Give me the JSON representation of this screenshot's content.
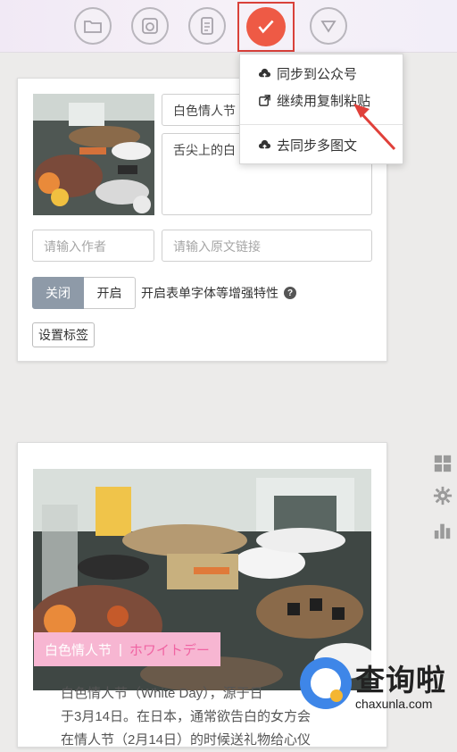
{
  "toolbar": {
    "buttons": [
      {
        "icon": "folder-icon"
      },
      {
        "icon": "camera-icon"
      },
      {
        "icon": "clipboard-icon"
      },
      {
        "icon": "check-icon",
        "active": true
      },
      {
        "icon": "triangle-down-icon"
      }
    ],
    "accent": "#ee5a45",
    "highlight_border": "#d9413a"
  },
  "sync_menu": {
    "items": [
      {
        "icon": "cloud-upload-icon",
        "label": "同步到公众号"
      },
      {
        "icon": "external-link-icon",
        "label": "继续用复制粘贴"
      },
      {
        "icon": "cloud-upload-icon",
        "label": "去同步多图文"
      }
    ]
  },
  "article_form": {
    "title_value": "白色情人节",
    "digest_value": "舌尖上的白",
    "author_placeholder": "请输入作者",
    "source_link_placeholder": "请输入原文链接",
    "toggle": {
      "off_label": "关闭",
      "on_label": "开启",
      "selected": "关闭"
    },
    "toggle_description": "开启表单字体等增强特性",
    "tag_button_label": "设置标签"
  },
  "article_preview": {
    "title": "白色情人节",
    "title_separator": "|",
    "title_jp": "ホワイトデー",
    "body_line1": "白色情人节（White Day），源于日",
    "body_line2": "于3月14日。在日本，通常欲告白的女方会",
    "body_line3": "在情人节（2月14日）的时候送礼物给心仪"
  },
  "watermark": {
    "title": "查询啦",
    "url": "chaxunla.com"
  }
}
